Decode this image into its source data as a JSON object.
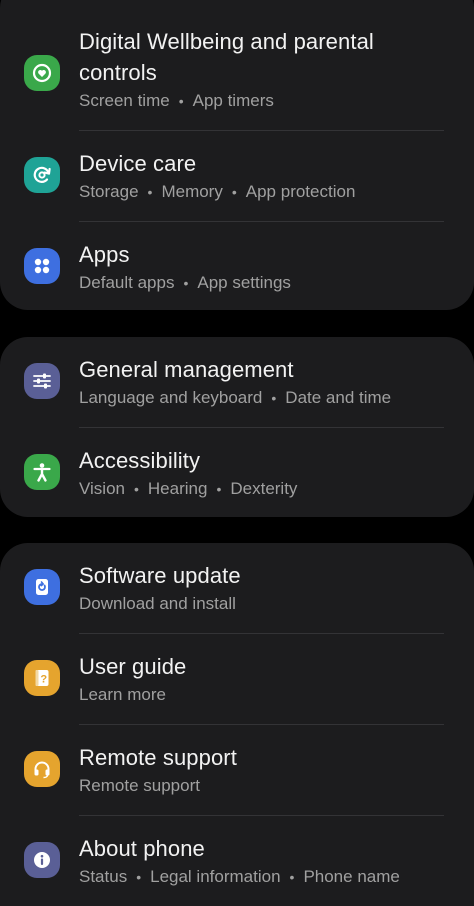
{
  "settings": {
    "wellbeing": {
      "title": "Digital Wellbeing and parental controls",
      "sub": [
        "Screen time",
        "App timers"
      ],
      "icon": "heart-circle-icon",
      "color": "#3aa84a"
    },
    "device_care": {
      "title": "Device care",
      "sub": [
        "Storage",
        "Memory",
        "App protection"
      ],
      "icon": "refresh-circle-icon",
      "color": "#1fa396"
    },
    "apps": {
      "title": "Apps",
      "sub": [
        "Default apps",
        "App settings"
      ],
      "icon": "four-dots-icon",
      "color": "#3e6fe0"
    },
    "general": {
      "title": "General management",
      "sub": [
        "Language and keyboard",
        "Date and time"
      ],
      "icon": "sliders-icon",
      "color": "#5a5f96"
    },
    "accessibility": {
      "title": "Accessibility",
      "sub": [
        "Vision",
        "Hearing",
        "Dexterity"
      ],
      "icon": "person-icon",
      "color": "#3aa84a"
    },
    "software": {
      "title": "Software update",
      "sub": [
        "Download and install"
      ],
      "icon": "update-icon",
      "color": "#3e6fe0"
    },
    "guide": {
      "title": "User guide",
      "sub": [
        "Learn more"
      ],
      "icon": "help-book-icon",
      "color": "#e5a42e"
    },
    "remote": {
      "title": "Remote support",
      "sub": [
        "Remote support"
      ],
      "icon": "headset-icon",
      "color": "#e5a42e"
    },
    "about": {
      "title": "About phone",
      "sub": [
        "Status",
        "Legal information",
        "Phone name"
      ],
      "icon": "info-icon",
      "color": "#5a5f96"
    }
  }
}
